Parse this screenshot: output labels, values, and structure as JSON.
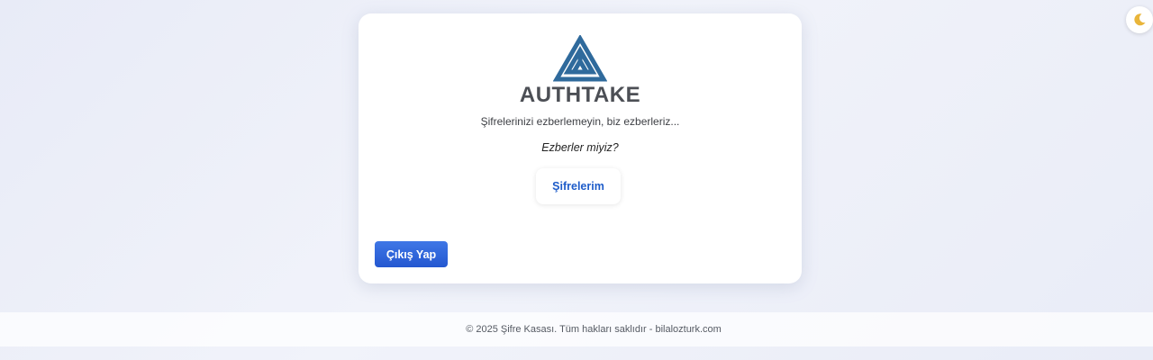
{
  "app": {
    "brand_name": "AUTHTAKE",
    "logo_icon": "triangle-maze-logo",
    "brand_color": "#2f6a9c",
    "accent_color": "#2457d0"
  },
  "hero": {
    "tagline": "Şifrelerinizi ezberlemeyin, biz ezberleriz...",
    "question": "Ezberler miyiz?"
  },
  "actions": {
    "passwords_label": "Şifrelerim",
    "logout_label": "Çıkış Yap"
  },
  "theme_toggle": {
    "icon": "moon-icon"
  },
  "footer": {
    "text": "© 2025 Şifre Kasası. Tüm hakları saklıdır - bilalozturk.com"
  }
}
